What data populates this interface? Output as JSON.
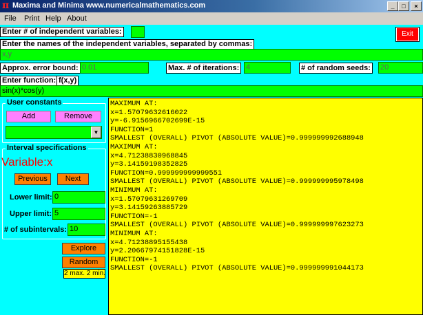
{
  "window": {
    "title": "Maxima and Minima  www.numericalmathematics.com",
    "icon": "pi-icon",
    "controls": [
      "_",
      "□",
      "×"
    ]
  },
  "menu": [
    "File",
    "Print",
    "Help",
    "About"
  ],
  "exit_label": "Exit",
  "num_vars": {
    "label": "Enter # of independent variables:",
    "value": ""
  },
  "var_names": {
    "label": "Enter the names of the independent variables, separated by commas:",
    "value": "x,y"
  },
  "error_bound": {
    "label": "Approx. error bound:",
    "value": "0.01"
  },
  "max_iter": {
    "label": "Max. # of iterations:",
    "value": "4"
  },
  "seeds": {
    "label": "# of random seeds:",
    "value": "20"
  },
  "function": {
    "label": "Enter function:",
    "fxy": "f(x,y)",
    "value": "sin(x)*cos(y)"
  },
  "user_constants": {
    "title": "User constants",
    "add": "Add",
    "remove": "Remove",
    "selected": ""
  },
  "interval": {
    "title": "Interval specifications",
    "variable": "Variable:x",
    "previous": "Previous",
    "next": "Next",
    "lower_label": "Lower limit:",
    "lower_value": "0",
    "upper_label": "Upper limit:",
    "upper_value": "5",
    "subint_label": "# of subintervals:",
    "subint_value": "10"
  },
  "explore_label": "Explore",
  "random_label": "Random",
  "status": "2 max. 2 min.",
  "output_lines": [
    "MAXIMUM AT:",
    "x=1.57079632616022",
    "y=-6.9156966702699E-15",
    "FUNCTION=1",
    "SMALLEST (OVERALL) PIVOT (ABSOLUTE VALUE)=0.999999992688948",
    "MAXIMUM AT:",
    "x=4.71238830968845",
    "y=3.14159198352825",
    "FUNCTION=0.999999999999551",
    "SMALLEST (OVERALL) PIVOT (ABSOLUTE VALUE)=0.999999995978498",
    "MINIMUM AT:",
    "x=1.57079631269709",
    "y=3.14159263885729",
    "FUNCTION=-1",
    "SMALLEST (OVERALL) PIVOT (ABSOLUTE VALUE)=0.999999997623273",
    "MINIMUM AT:",
    "x=4.71238895155438",
    "y=2.20667974151828E-15",
    "FUNCTION=-1",
    "SMALLEST (OVERALL) PIVOT (ABSOLUTE VALUE)=0.999999991044173"
  ]
}
